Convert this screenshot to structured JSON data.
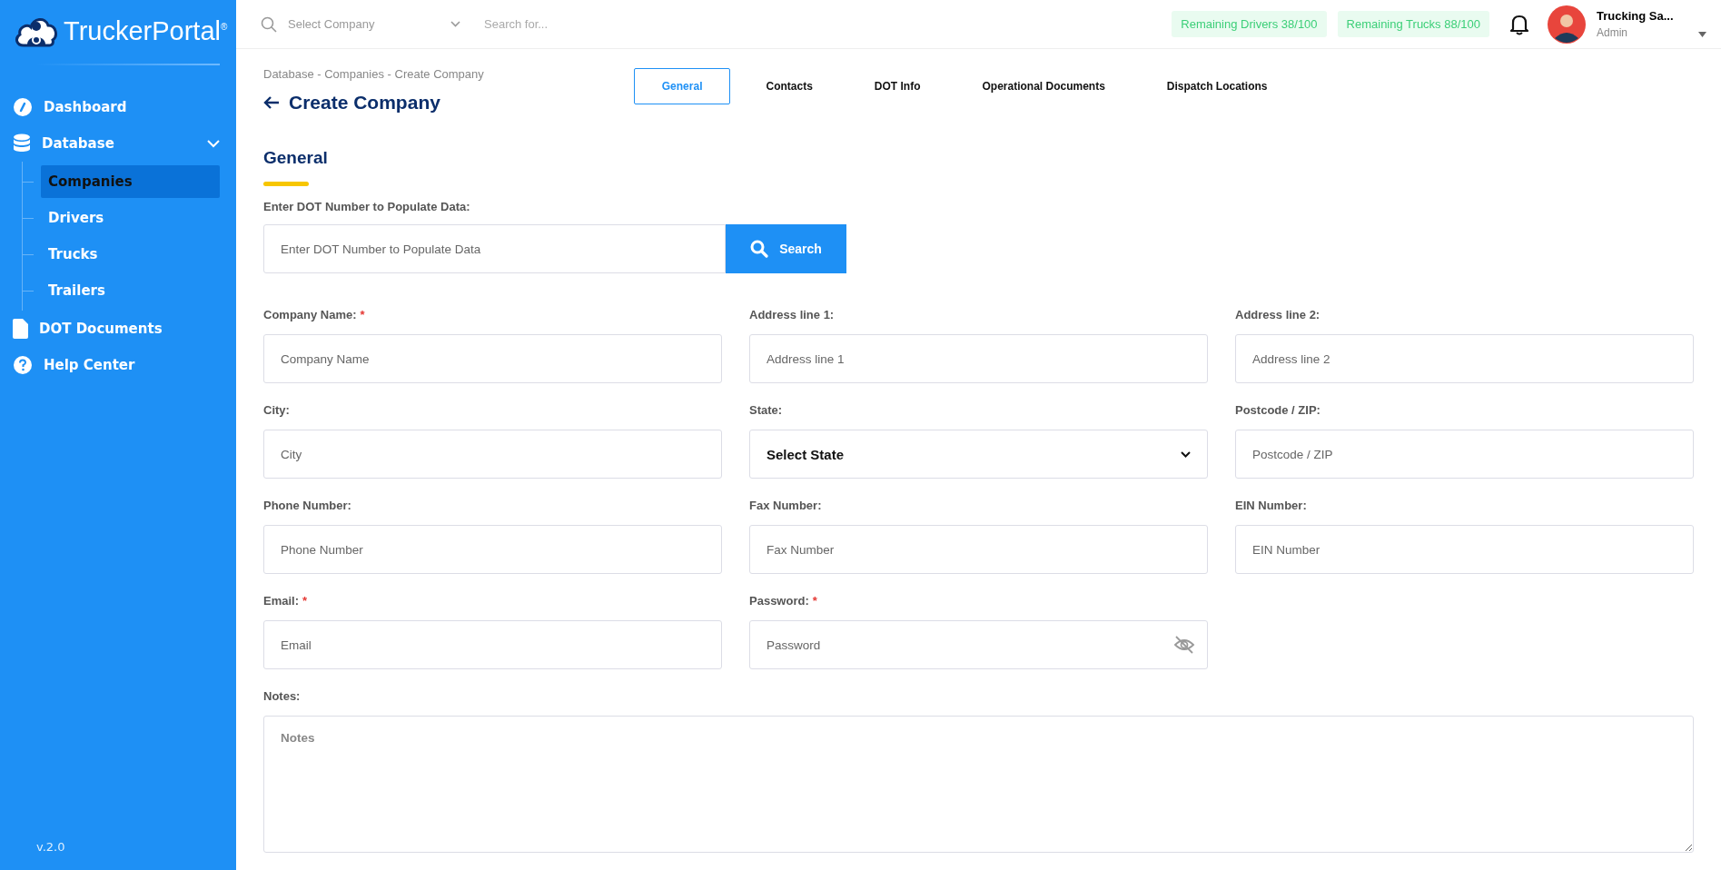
{
  "logo": {
    "text": "TruckerPortal",
    "mark": "®"
  },
  "sidebar": {
    "items": [
      {
        "label": "Dashboard",
        "selected": false
      },
      {
        "label": "Database",
        "selected": false,
        "expanded": true,
        "children": [
          {
            "label": "Companies",
            "selected": true
          },
          {
            "label": "Drivers",
            "selected": false
          },
          {
            "label": "Trucks",
            "selected": false
          },
          {
            "label": "Trailers",
            "selected": false
          }
        ]
      },
      {
        "label": "DOT Documents",
        "selected": false
      },
      {
        "label": "Help Center",
        "selected": false
      }
    ],
    "version": "v.2.0"
  },
  "topbar": {
    "company_select": {
      "placeholder": "Select Company"
    },
    "search": {
      "placeholder": "Search for..."
    },
    "badges": [
      "Remaining Drivers 38/100",
      "Remaining Trucks 88/100"
    ],
    "user": {
      "name": "Trucking Sa...",
      "role": "Admin"
    }
  },
  "breadcrumb": "Database - Companies - Create Company",
  "page_title": "Create Company",
  "tabs": [
    {
      "label": "General",
      "selected": true
    },
    {
      "label": "Contacts",
      "selected": false
    },
    {
      "label": "DOT Info",
      "selected": false
    },
    {
      "label": "Operational Documents",
      "selected": false
    },
    {
      "label": "Dispatch Locations",
      "selected": false
    }
  ],
  "section_title": "General",
  "dot_lookup": {
    "label": "Enter DOT Number to Populate Data:",
    "placeholder": "Enter DOT Number to Populate Data",
    "button": "Search"
  },
  "fields": [
    {
      "kind": "text",
      "label": "Company Name:",
      "required_mark": "*",
      "placeholder": "Company Name"
    },
    {
      "kind": "text",
      "label": "Address line 1:",
      "placeholder": "Address line 1"
    },
    {
      "kind": "text",
      "label": "Address line 2:",
      "placeholder": "Address line 2"
    },
    {
      "kind": "text",
      "label": "City:",
      "placeholder": "City"
    },
    {
      "kind": "select",
      "label": "State:",
      "value": "Select State"
    },
    {
      "kind": "text",
      "label": "Postcode / ZIP:",
      "placeholder": "Postcode / ZIP"
    },
    {
      "kind": "text",
      "label": "Phone Number:",
      "placeholder": "Phone Number"
    },
    {
      "kind": "text",
      "label": "Fax Number:",
      "placeholder": "Fax Number"
    },
    {
      "kind": "text",
      "label": "EIN Number:",
      "placeholder": "EIN Number"
    },
    {
      "kind": "text",
      "label": "Email:",
      "required_mark": "*",
      "placeholder": "Email"
    },
    {
      "kind": "password",
      "label": "Password:",
      "required_mark": "*",
      "placeholder": "Password"
    },
    {
      "kind": "textarea",
      "label": "Notes:",
      "placeholder": "Notes"
    }
  ]
}
